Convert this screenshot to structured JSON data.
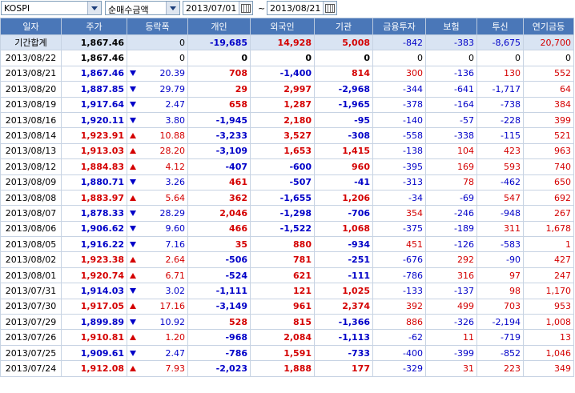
{
  "toolbar": {
    "market": "KOSPI",
    "mode": "순매수금액",
    "date_from": "2013/07/01",
    "separator": "~",
    "date_to": "2013/08/21"
  },
  "columns": [
    "일자",
    "주가",
    "등락폭",
    "개인",
    "외국인",
    "기관",
    "금융투자",
    "보험",
    "투신",
    "연기금등"
  ],
  "colors": {
    "up": "#d40000",
    "down": "#0000c8",
    "header_bg": "#4a77b8",
    "summary_bg": "#d9e4f3"
  },
  "summary": {
    "date": "기간합계",
    "price": "1,867.46",
    "change": "0",
    "individual": "-19,685",
    "foreign": "14,928",
    "institution": "5,008",
    "finance": "-842",
    "insurance": "-383",
    "trust": "-8,675",
    "pension": "20,700"
  },
  "rows": [
    {
      "date": "2013/08/22",
      "price": "1,867.46",
      "dir": "flat",
      "change": "0",
      "individual": "0",
      "foreign": "0",
      "institution": "0",
      "finance": "0",
      "insurance": "0",
      "trust": "0",
      "pension": "0"
    },
    {
      "date": "2013/08/21",
      "price": "1,867.46",
      "dir": "down",
      "change": "20.39",
      "individual": "708",
      "foreign": "-1,400",
      "institution": "814",
      "finance": "300",
      "insurance": "-136",
      "trust": "130",
      "pension": "552"
    },
    {
      "date": "2013/08/20",
      "price": "1,887.85",
      "dir": "down",
      "change": "29.79",
      "individual": "29",
      "foreign": "2,997",
      "institution": "-2,968",
      "finance": "-344",
      "insurance": "-641",
      "trust": "-1,717",
      "pension": "64"
    },
    {
      "date": "2013/08/19",
      "price": "1,917.64",
      "dir": "down",
      "change": "2.47",
      "individual": "658",
      "foreign": "1,287",
      "institution": "-1,965",
      "finance": "-378",
      "insurance": "-164",
      "trust": "-738",
      "pension": "384"
    },
    {
      "date": "2013/08/16",
      "price": "1,920.11",
      "dir": "down",
      "change": "3.80",
      "individual": "-1,945",
      "foreign": "2,180",
      "institution": "-95",
      "finance": "-140",
      "insurance": "-57",
      "trust": "-228",
      "pension": "399"
    },
    {
      "date": "2013/08/14",
      "price": "1,923.91",
      "dir": "up",
      "change": "10.88",
      "individual": "-3,233",
      "foreign": "3,527",
      "institution": "-308",
      "finance": "-558",
      "insurance": "-338",
      "trust": "-115",
      "pension": "521"
    },
    {
      "date": "2013/08/13",
      "price": "1,913.03",
      "dir": "up",
      "change": "28.20",
      "individual": "-3,109",
      "foreign": "1,653",
      "institution": "1,415",
      "finance": "-138",
      "insurance": "104",
      "trust": "423",
      "pension": "963"
    },
    {
      "date": "2013/08/12",
      "price": "1,884.83",
      "dir": "up",
      "change": "4.12",
      "individual": "-407",
      "foreign": "-600",
      "institution": "960",
      "finance": "-395",
      "insurance": "169",
      "trust": "593",
      "pension": "740"
    },
    {
      "date": "2013/08/09",
      "price": "1,880.71",
      "dir": "down",
      "change": "3.26",
      "individual": "461",
      "foreign": "-507",
      "institution": "-41",
      "finance": "-313",
      "insurance": "78",
      "trust": "-462",
      "pension": "650"
    },
    {
      "date": "2013/08/08",
      "price": "1,883.97",
      "dir": "up",
      "change": "5.64",
      "individual": "362",
      "foreign": "-1,655",
      "institution": "1,206",
      "finance": "-34",
      "insurance": "-69",
      "trust": "547",
      "pension": "692"
    },
    {
      "date": "2013/08/07",
      "price": "1,878.33",
      "dir": "down",
      "change": "28.29",
      "individual": "2,046",
      "foreign": "-1,298",
      "institution": "-706",
      "finance": "354",
      "insurance": "-246",
      "trust": "-948",
      "pension": "267"
    },
    {
      "date": "2013/08/06",
      "price": "1,906.62",
      "dir": "down",
      "change": "9.60",
      "individual": "466",
      "foreign": "-1,522",
      "institution": "1,068",
      "finance": "-375",
      "insurance": "-189",
      "trust": "311",
      "pension": "1,678"
    },
    {
      "date": "2013/08/05",
      "price": "1,916.22",
      "dir": "down",
      "change": "7.16",
      "individual": "35",
      "foreign": "880",
      "institution": "-934",
      "finance": "451",
      "insurance": "-126",
      "trust": "-583",
      "pension": "1"
    },
    {
      "date": "2013/08/02",
      "price": "1,923.38",
      "dir": "up",
      "change": "2.64",
      "individual": "-506",
      "foreign": "781",
      "institution": "-251",
      "finance": "-676",
      "insurance": "292",
      "trust": "-90",
      "pension": "427"
    },
    {
      "date": "2013/08/01",
      "price": "1,920.74",
      "dir": "up",
      "change": "6.71",
      "individual": "-524",
      "foreign": "621",
      "institution": "-111",
      "finance": "-786",
      "insurance": "316",
      "trust": "97",
      "pension": "247"
    },
    {
      "date": "2013/07/31",
      "price": "1,914.03",
      "dir": "down",
      "change": "3.02",
      "individual": "-1,111",
      "foreign": "121",
      "institution": "1,025",
      "finance": "-133",
      "insurance": "-137",
      "trust": "98",
      "pension": "1,170"
    },
    {
      "date": "2013/07/30",
      "price": "1,917.05",
      "dir": "up",
      "change": "17.16",
      "individual": "-3,149",
      "foreign": "961",
      "institution": "2,374",
      "finance": "392",
      "insurance": "499",
      "trust": "703",
      "pension": "953"
    },
    {
      "date": "2013/07/29",
      "price": "1,899.89",
      "dir": "down",
      "change": "10.92",
      "individual": "528",
      "foreign": "815",
      "institution": "-1,366",
      "finance": "886",
      "insurance": "-326",
      "trust": "-2,194",
      "pension": "1,008"
    },
    {
      "date": "2013/07/26",
      "price": "1,910.81",
      "dir": "up",
      "change": "1.20",
      "individual": "-968",
      "foreign": "2,084",
      "institution": "-1,113",
      "finance": "-62",
      "insurance": "11",
      "trust": "-719",
      "pension": "13"
    },
    {
      "date": "2013/07/25",
      "price": "1,909.61",
      "dir": "down",
      "change": "2.47",
      "individual": "-786",
      "foreign": "1,591",
      "institution": "-733",
      "finance": "-400",
      "insurance": "-399",
      "trust": "-852",
      "pension": "1,046"
    },
    {
      "date": "2013/07/24",
      "price": "1,912.08",
      "dir": "up",
      "change": "7.93",
      "individual": "-2,023",
      "foreign": "1,888",
      "institution": "177",
      "finance": "-329",
      "insurance": "31",
      "trust": "223",
      "pension": "349"
    }
  ]
}
